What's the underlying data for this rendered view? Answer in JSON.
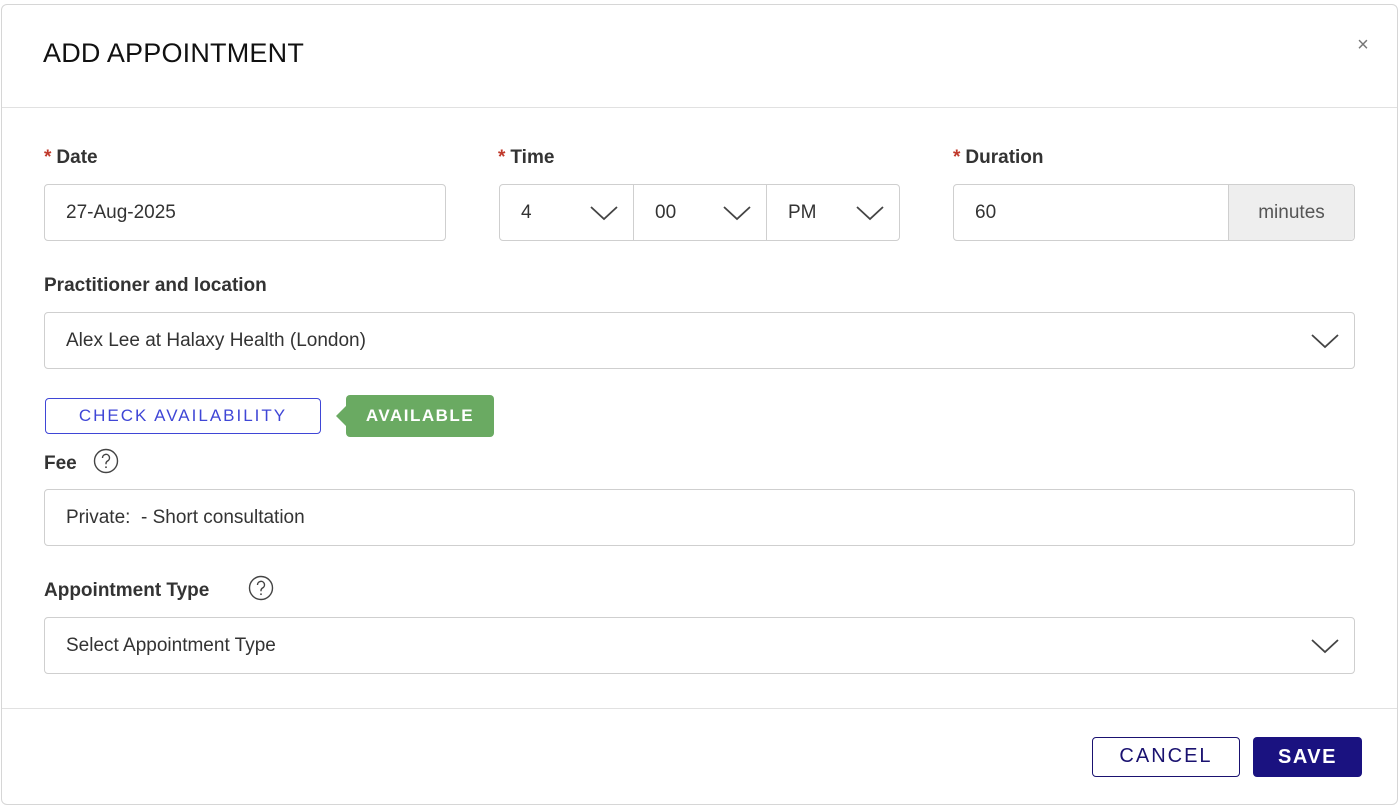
{
  "dialog": {
    "title": "ADD APPOINTMENT",
    "close_glyph": "×"
  },
  "date": {
    "label": "Date",
    "required_mark": "*",
    "value": "27-Aug-2025"
  },
  "time": {
    "label": "Time",
    "required_mark": "*",
    "hour": "4",
    "minute": "00",
    "meridiem": "PM"
  },
  "duration": {
    "label": "Duration",
    "required_mark": "*",
    "value": "60",
    "unit": "minutes"
  },
  "practitioner": {
    "label": "Practitioner and location",
    "value": "Alex Lee at Halaxy Health (London)"
  },
  "availability": {
    "check_label": "CHECK AVAILABILITY",
    "status": "AVAILABLE",
    "status_color": "#6aaa62"
  },
  "fee": {
    "label": "Fee",
    "value": "Private:  - Short consultation",
    "help_icon": "question-circle-icon"
  },
  "appointment_type": {
    "label": "Appointment Type",
    "placeholder": "Select Appointment Type",
    "help_icon": "question-circle-icon"
  },
  "actions": {
    "cancel_label": "CANCEL",
    "save_label": "SAVE",
    "primary_color": "#1a1280"
  }
}
